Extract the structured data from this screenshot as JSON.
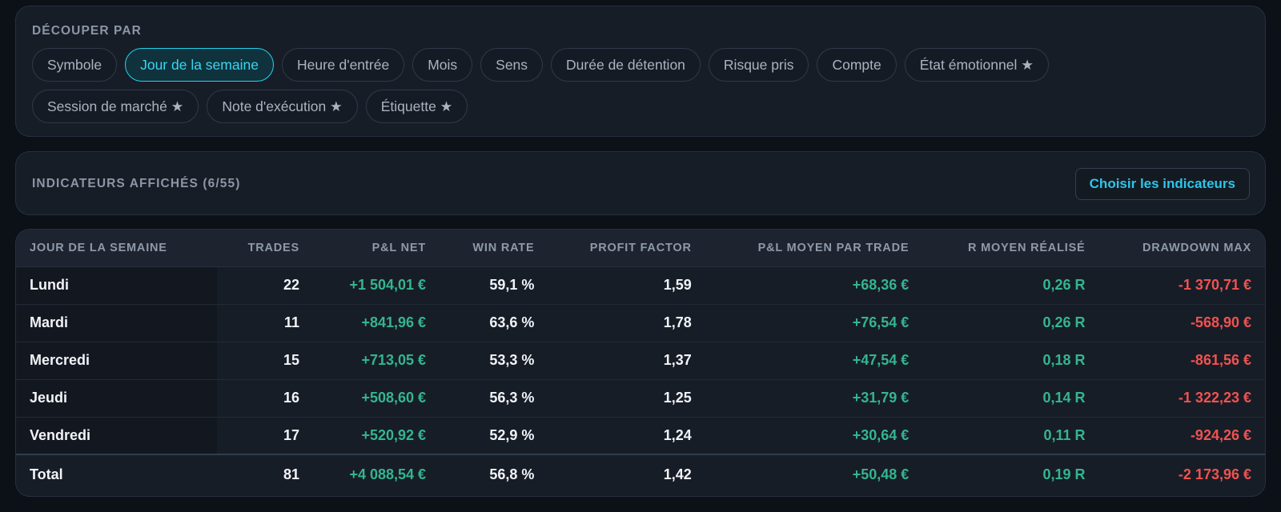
{
  "split_section": {
    "title": "DÉCOUPER PAR",
    "selected": "Jour de la semaine",
    "chips": [
      "Symbole",
      "Jour de la semaine",
      "Heure d'entrée",
      "Mois",
      "Sens",
      "Durée de détention",
      "Risque pris",
      "Compte",
      "État émotionnel ★",
      "Session de marché ★",
      "Note d'exécution ★",
      "Étiquette ★"
    ]
  },
  "metrics_section": {
    "title": "INDICATEURS AFFICHÉS (6/55)",
    "choose_label": "Choisir les indicateurs"
  },
  "table": {
    "headers": [
      "JOUR DE LA SEMAINE",
      "TRADES",
      "P&L NET",
      "WIN RATE",
      "PROFIT FACTOR",
      "P&L MOYEN PAR TRADE",
      "R MOYEN RÉALISÉ",
      "DRAWDOWN MAX"
    ],
    "rows": [
      [
        "Lundi",
        "22",
        "+1 504,01 €",
        "59,1 %",
        "1,59",
        "+68,36 €",
        "0,26 R",
        "-1 370,71 €"
      ],
      [
        "Mardi",
        "11",
        "+841,96 €",
        "63,6 %",
        "1,78",
        "+76,54 €",
        "0,26 R",
        "-568,90 €"
      ],
      [
        "Mercredi",
        "15",
        "+713,05 €",
        "53,3 %",
        "1,37",
        "+47,54 €",
        "0,18 R",
        "-861,56 €"
      ],
      [
        "Jeudi",
        "16",
        "+508,60 €",
        "56,3 %",
        "1,25",
        "+31,79 €",
        "0,14 R",
        "-1 322,23 €"
      ],
      [
        "Vendredi",
        "17",
        "+520,92 €",
        "52,9 %",
        "1,24",
        "+30,64 €",
        "0,11 R",
        "-924,26 €"
      ]
    ],
    "total": [
      "Total",
      "81",
      "+4 088,54 €",
      "56,8 %",
      "1,42",
      "+50,48 €",
      "0,19 R",
      "-2 173,96 €"
    ]
  },
  "colors": {
    "accent": "#22d3ee",
    "positive": "#34b58f",
    "negative": "#ef5350",
    "background": "#0c1017",
    "panel": "#171d27"
  }
}
